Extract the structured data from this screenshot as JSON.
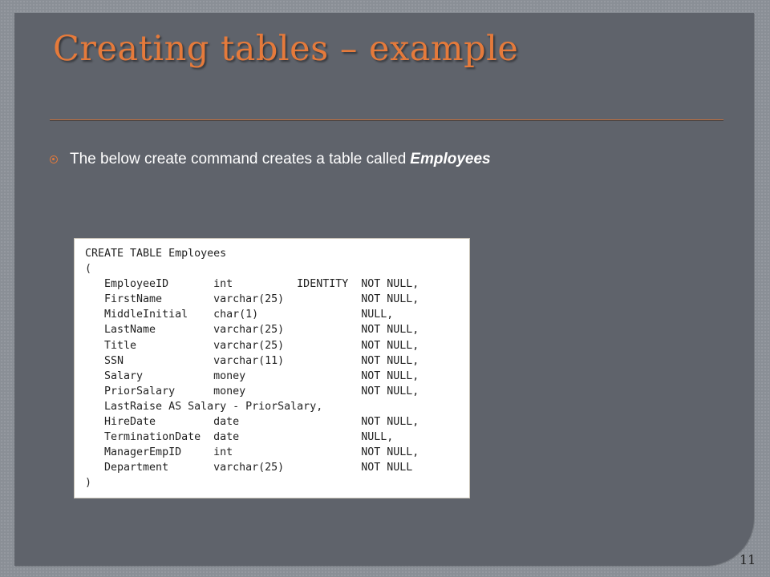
{
  "slide": {
    "title": "Creating tables – example",
    "bullet": {
      "text": "The below create command creates a table called",
      "emphasis": "Employees"
    },
    "code_lines": [
      "CREATE TABLE Employees",
      "(",
      "   EmployeeID       int          IDENTITY  NOT NULL,",
      "   FirstName        varchar(25)            NOT NULL,",
      "   MiddleInitial    char(1)                NULL,",
      "   LastName         varchar(25)            NOT NULL,",
      "   Title            varchar(25)            NOT NULL,",
      "   SSN              varchar(11)            NOT NULL,",
      "   Salary           money                  NOT NULL,",
      "   PriorSalary      money                  NOT NULL,",
      "   LastRaise AS Salary - PriorSalary,",
      "   HireDate         date                   NOT NULL,",
      "   TerminationDate  date                   NULL,",
      "   ManagerEmpID     int                    NOT NULL,",
      "   Department       varchar(25)            NOT NULL",
      ")"
    ],
    "page_number": "11"
  },
  "colors": {
    "background": "#8a8f96",
    "panel": "#5f636b",
    "accent": "#e57a3b",
    "text": "#ffffff"
  },
  "icons": {
    "bullet": "circle-bullet-icon"
  }
}
